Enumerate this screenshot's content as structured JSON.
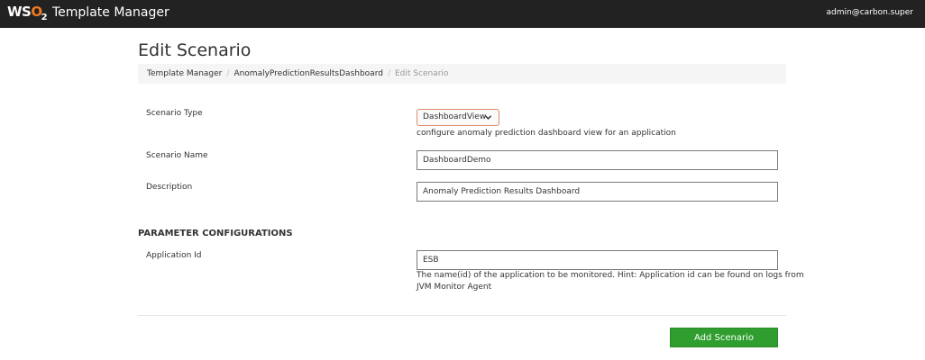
{
  "header": {
    "logo": {
      "w": "WS",
      "o": "O",
      "sub": "2",
      "icon": "wso2-logo"
    },
    "app_title": "Template Manager",
    "user": "admin@carbon.super"
  },
  "page": {
    "title": "Edit Scenario",
    "breadcrumb": [
      "Template Manager",
      "AnomalyPredictionResultsDashboard",
      "Edit Scenario"
    ]
  },
  "form": {
    "scenario_type": {
      "label": "Scenario Type",
      "selected": "DashboardView",
      "description": "configure anomaly prediction dashboard view for an application"
    },
    "scenario_name": {
      "label": "Scenario Name",
      "value": "DashboardDemo"
    },
    "description": {
      "label": "Description",
      "value": "Anomaly Prediction Results Dashboard"
    }
  },
  "parameters": {
    "section_title": "PARAMETER CONFIGURATIONS",
    "application_id": {
      "label": "Application Id",
      "value": "ESB",
      "hint_line1": "The name(id) of the application to be monitored. Hint: Application id can be found on logs from",
      "hint_line2": "JVM Monitor Agent"
    }
  },
  "actions": {
    "add_label": "Add Scenario"
  },
  "colors": {
    "topbar": "#222222",
    "accent": "#f47b20",
    "primary_button": "#2f9e2f",
    "select_border": "#e38b6b"
  }
}
